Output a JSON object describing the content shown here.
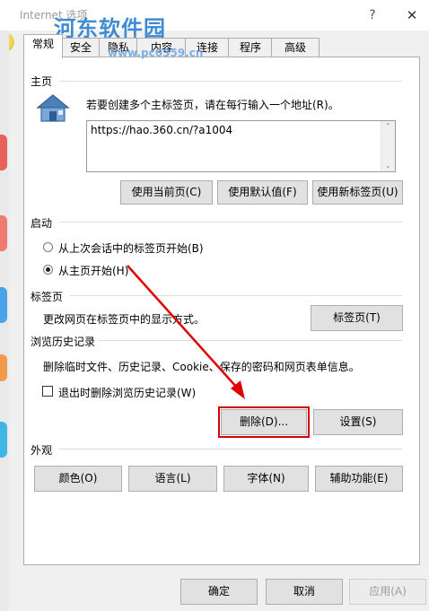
{
  "window": {
    "title": "Internet 选项",
    "watermark": "河东软件园",
    "watermark_url": "www.pc0359.cn",
    "help": "?",
    "close": "✕"
  },
  "tabs": [
    {
      "label": "常规",
      "active": true
    },
    {
      "label": "安全"
    },
    {
      "label": "隐私"
    },
    {
      "label": "内容"
    },
    {
      "label": "连接"
    },
    {
      "label": "程序"
    },
    {
      "label": "高级"
    }
  ],
  "homepage": {
    "section": "主页",
    "description": "若要创建多个主标签页，请在每行输入一个地址(R)。",
    "url": "https://hao.360.cn/?a1004",
    "use_current": "使用当前页(C)",
    "use_default": "使用默认值(F)",
    "use_new_tab": "使用新标签页(U)"
  },
  "startup": {
    "section": "启动",
    "option1": "从上次会话中的标签页开始(B)",
    "option2": "从主页开始(H)",
    "selected": 2
  },
  "tabs_section": {
    "section": "标签页",
    "description": "更改网页在标签页中的显示方式。",
    "button": "标签页(T)"
  },
  "history": {
    "section": "浏览历史记录",
    "description": "删除临时文件、历史记录、Cookie、保存的密码和网页表单信息。",
    "checkbox_label": "退出时删除浏览历史记录(W)",
    "checkbox_checked": false,
    "delete": "删除(D)...",
    "settings": "设置(S)"
  },
  "appearance": {
    "section": "外观",
    "colors": "颜色(O)",
    "languages": "语言(L)",
    "fonts": "字体(N)",
    "accessibility": "辅助功能(E)"
  },
  "footer": {
    "ok": "确定",
    "cancel": "取消",
    "apply": "应用(A)"
  },
  "colors": {
    "highlight": "#d50000",
    "arrow": "#e00000",
    "watermark": "#2d7fd1"
  }
}
